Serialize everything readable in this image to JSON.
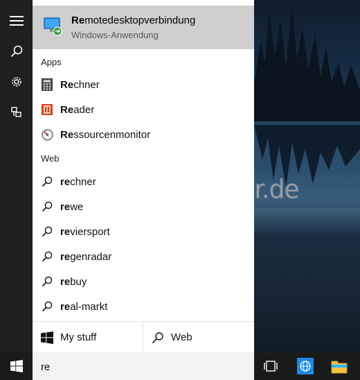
{
  "colors": {
    "rail_bg": "#1f1f1f",
    "panel_bg": "#ffffff",
    "highlight_bg": "#cfcfcf",
    "taskbar_bg": "#1a1a1a",
    "accent_blue": "#1e88e5"
  },
  "rail": {
    "items": [
      {
        "icon": "hamburger-menu-icon"
      },
      {
        "icon": "search-icon"
      },
      {
        "icon": "gear-icon"
      },
      {
        "icon": "feedback-icon"
      }
    ]
  },
  "best_match": {
    "title_bold": "Re",
    "title_rest": "motedesktopverbindung",
    "subtitle": "Windows-Anwendung",
    "icon": "remote-desktop-icon"
  },
  "apps": {
    "heading": "Apps",
    "items": [
      {
        "bold": "Re",
        "rest": "chner",
        "icon": "calculator-icon"
      },
      {
        "bold": "Re",
        "rest": "ader",
        "icon": "reader-icon"
      },
      {
        "bold": "Re",
        "rest": "ssourcenmonitor",
        "icon": "resource-monitor-icon"
      }
    ]
  },
  "web": {
    "heading": "Web",
    "items": [
      {
        "bold": "re",
        "rest": "chner"
      },
      {
        "bold": "re",
        "rest": "we"
      },
      {
        "bold": "re",
        "rest": "viersport"
      },
      {
        "bold": "re",
        "rest": "genradar"
      },
      {
        "bold": "re",
        "rest": "buy"
      },
      {
        "bold": "re",
        "rest": "al-markt"
      }
    ]
  },
  "footer": {
    "my_stuff_label": "My stuff",
    "web_label": "Web"
  },
  "search": {
    "value": "re"
  },
  "watermark": "Deskmodder.de"
}
